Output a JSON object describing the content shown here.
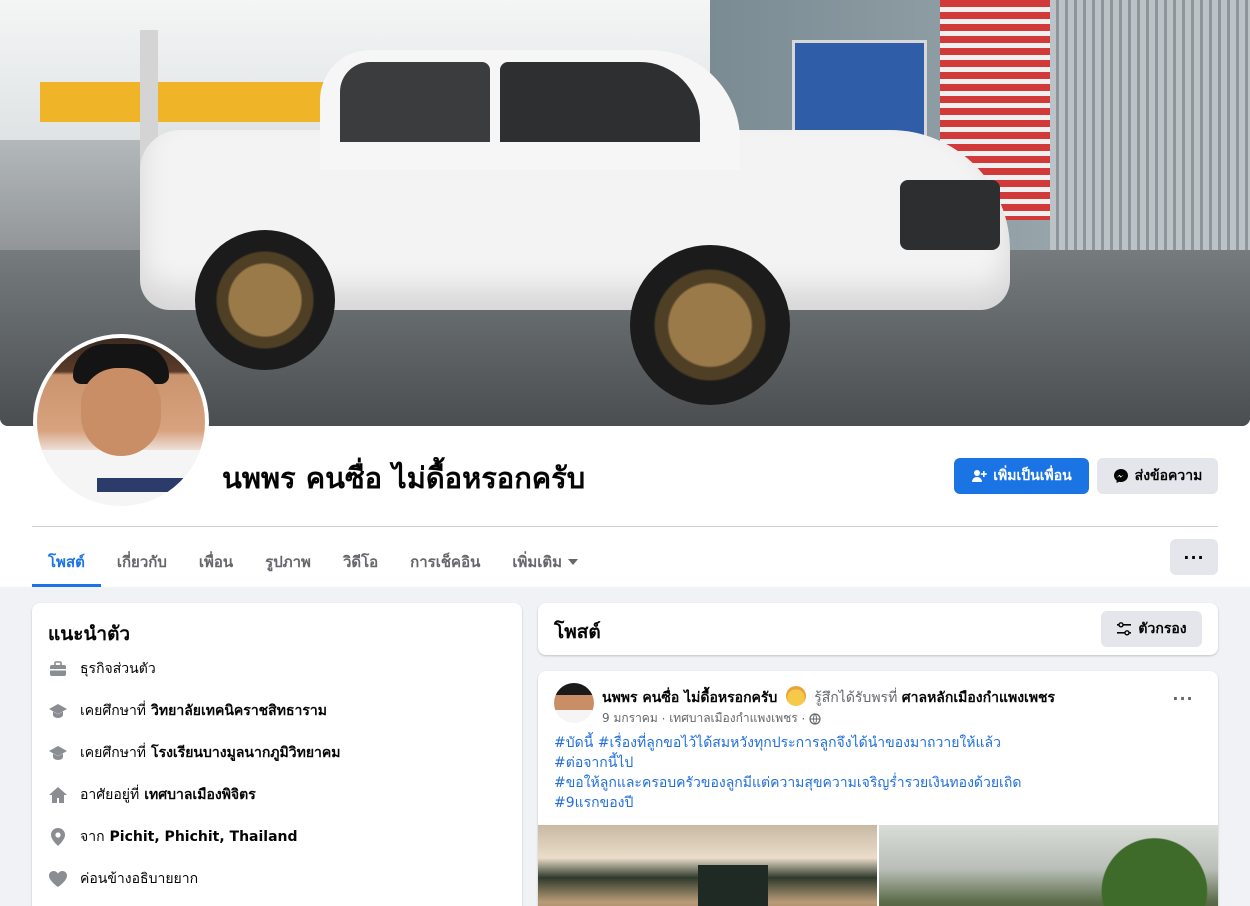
{
  "profile": {
    "name": "นพพร คนซื่อ ไม่ดื้อหรอกครับ",
    "add_friend_label": "เพิ่มเป็นเพื่อน",
    "message_label": "ส่งข้อความ"
  },
  "tabs": [
    {
      "label": "โพสต์",
      "active": true
    },
    {
      "label": "เกี่ยวกับ",
      "active": false
    },
    {
      "label": "เพื่อน",
      "active": false
    },
    {
      "label": "รูปภาพ",
      "active": false
    },
    {
      "label": "วิดีโอ",
      "active": false
    },
    {
      "label": "การเช็คอิน",
      "active": false
    },
    {
      "label": "เพิ่มเติม",
      "active": false
    }
  ],
  "more_label": "···",
  "intro": {
    "title": "แนะนำตัว",
    "items": [
      {
        "icon": "briefcase-icon",
        "text": "ธุรกิจส่วนตัว",
        "bold": ""
      },
      {
        "icon": "graduation-cap-icon",
        "text": "เคยศึกษาที่",
        "bold": "วิทยาลัยเทคนิคราชสิทธาราม"
      },
      {
        "icon": "graduation-cap-icon",
        "text": "เคยศึกษาที่",
        "bold": "โรงเรียนบางมูลนากภูมิวิทยาคม"
      },
      {
        "icon": "home-icon",
        "text": "อาศัยอยู่ที่",
        "bold": "เทศบาลเมืองพิจิตร"
      },
      {
        "icon": "location-pin-icon",
        "text": "จาก",
        "bold": "Pichit, Phichit, Thailand"
      },
      {
        "icon": "heart-icon",
        "text": "ค่อนข้างอธิบายยาก",
        "bold": ""
      }
    ]
  },
  "posts_section": {
    "title": "โพสต์",
    "filter_label": "ตัวกรอง"
  },
  "post": {
    "author": "นพพร คนซื่อ ไม่ดื้อหรอกครับ",
    "feeling": "รู้สึกได้รับพรที่",
    "place": "ศาลหลักเมืองกำแพงเพชร",
    "date": "9 มกราคม",
    "location": "เทศบาลเมืองกำแพงเพชร",
    "dots": "···",
    "lines": [
      "#บัดนี้ #เรื่องที่ลูกขอไว้ได้สมหวังทุกประการลูกจึงได้นำของมาถวายให้แล้ว",
      "#ต่อจากนี้ไป",
      "#ขอให้ลูกและครอบครัวของลูกมีแต่ความสุขความเจริญร่ำรวยเงินทองด้วยเถิด",
      "#9แรกของปี"
    ]
  },
  "colors": {
    "accent": "#1b74e4",
    "hashtag": "#216fdb",
    "background": "#f0f2f5"
  }
}
